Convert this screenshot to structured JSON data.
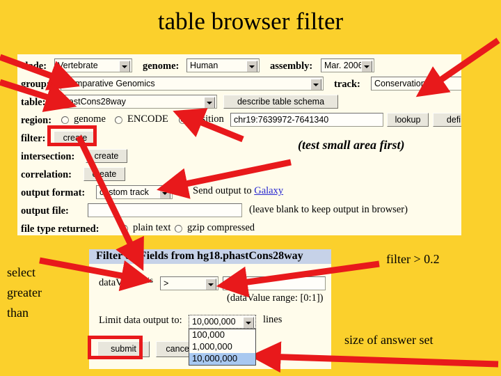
{
  "slide": {
    "title": "table browser filter",
    "background_color": "#FBD02C",
    "panel_color": "#FFFCEB",
    "accent_color": "#E8191B"
  },
  "form": {
    "rows": {
      "clade": {
        "label": "clade:",
        "value": "Vertebrate"
      },
      "genome": {
        "label": "genome:",
        "value": "Human"
      },
      "assembly": {
        "label": "assembly:",
        "value": "Mar. 2006"
      },
      "group": {
        "label": "group:",
        "value": "Comparative Genomics"
      },
      "track": {
        "label": "track:",
        "value": "Conservation"
      },
      "table": {
        "label": "table:",
        "value": "phastCons28way",
        "describe_button": "describe table schema"
      },
      "region": {
        "label": "region:",
        "option_genome": "genome",
        "option_encode": "ENCODE",
        "option_position": "position",
        "position_value": "chr19:7639972-7641340",
        "lookup_button": "lookup",
        "define_button": "defi"
      },
      "filter": {
        "label": "filter:",
        "create_button": "create"
      },
      "intersection": {
        "label": "intersection:",
        "create_button": "create"
      },
      "correlation": {
        "label": "correlation:",
        "create_button": "create"
      },
      "output_format": {
        "label": "output format:",
        "value": "custom track",
        "send_text": "Send output to ",
        "galaxy_link": "Galaxy"
      },
      "output_file": {
        "label": "output file:",
        "value": "",
        "hint": "(leave blank to keep output in browser)"
      },
      "file_type": {
        "label": "file type returned:",
        "option_plain": "plain text",
        "option_gzip": "gzip compressed"
      }
    }
  },
  "filter_dialog": {
    "header": "Filter on Fields from hg18.phastCons28way",
    "field_label": "dataValue",
    "is_label": "is",
    "operator": ">",
    "threshold": "0.2",
    "range_hint": "(dataValue range: [0:1])",
    "limit_label": "Limit data output to:",
    "limit_value": "10,000,000",
    "lines_label": "lines",
    "limit_options": [
      "100,000",
      "1,000,000",
      "10,000,000"
    ],
    "submit_button": "submit",
    "cancel_button": "cancel"
  },
  "annotations": {
    "test_small_area": "(test small area first)",
    "select_greater_than": "select\ngreater\nthan",
    "select_line1": "select",
    "select_line2": "greater",
    "select_line3": "than",
    "filter_gt": "filter > 0.2",
    "size_of_answer_set": "size of answer set"
  }
}
